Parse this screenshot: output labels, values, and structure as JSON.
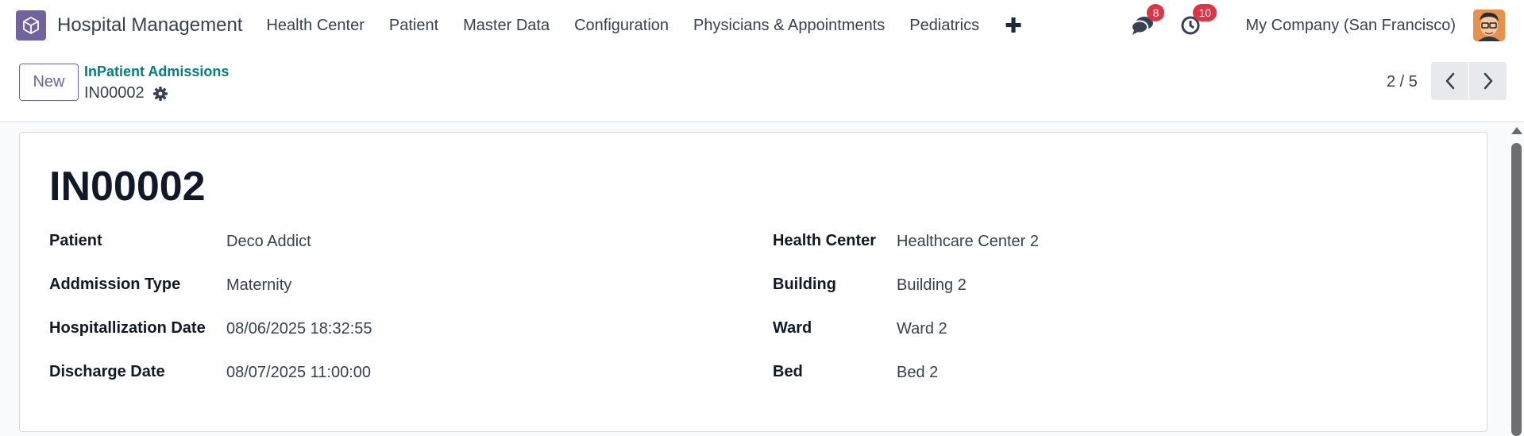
{
  "navbar": {
    "app_title": "Hospital Management",
    "menu": [
      "Health Center",
      "Patient",
      "Master Data",
      "Configuration",
      "Physicians & Appointments",
      "Pediatrics"
    ],
    "add_icon": "plus-icon",
    "messages_count": "8",
    "activities_count": "10",
    "company": "My Company (San Francisco)"
  },
  "control_panel": {
    "new_label": "New",
    "breadcrumb_parent": "InPatient Admissions",
    "current_record": "IN00002",
    "pager": "2 / 5"
  },
  "form": {
    "title": "IN00002",
    "left_fields": [
      {
        "label": "Patient",
        "value": "Deco Addict"
      },
      {
        "label": "Addmission Type",
        "value": "Maternity"
      },
      {
        "label": "Hospitallization Date",
        "value": "08/06/2025 18:32:55"
      },
      {
        "label": "Discharge Date",
        "value": "08/07/2025 11:00:00"
      }
    ],
    "right_fields": [
      {
        "label": "Health Center",
        "value": "Healthcare Center 2"
      },
      {
        "label": "Building",
        "value": "Building 2"
      },
      {
        "label": "Ward",
        "value": "Ward 2"
      },
      {
        "label": "Bed",
        "value": "Bed 2"
      }
    ]
  },
  "colors": {
    "brand": "#71639e",
    "link": "#017e84",
    "badge": "#dc3545"
  }
}
